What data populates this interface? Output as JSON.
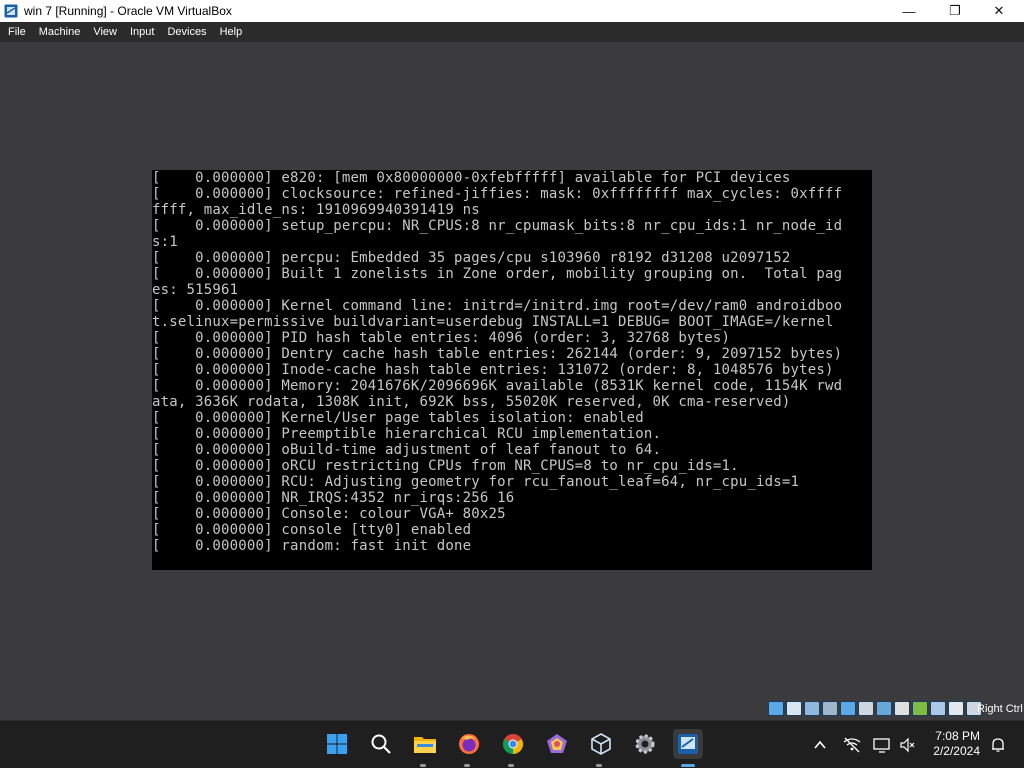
{
  "window": {
    "title": "win 7 [Running] - Oracle VM VirtualBox",
    "minimize": "—",
    "maximize": "❐",
    "close": "✕"
  },
  "menu": [
    "File",
    "Machine",
    "View",
    "Input",
    "Devices",
    "Help"
  ],
  "console": {
    "lines": [
      "[    0.000000] e820: [mem 0x80000000-0xfebfffff] available for PCI devices",
      "[    0.000000] clocksource: refined-jiffies: mask: 0xffffffff max_cycles: 0xffff",
      "ffff, max_idle_ns: 1910969940391419 ns",
      "[    0.000000] setup_percpu: NR_CPUS:8 nr_cpumask_bits:8 nr_cpu_ids:1 nr_node_id",
      "s:1",
      "[    0.000000] percpu: Embedded 35 pages/cpu s103960 r8192 d31208 u2097152",
      "[    0.000000] Built 1 zonelists in Zone order, mobility grouping on.  Total pag",
      "es: 515961",
      "[    0.000000] Kernel command line: initrd=/initrd.img root=/dev/ram0 androidboo",
      "t.selinux=permissive buildvariant=userdebug INSTALL=1 DEBUG= BOOT_IMAGE=/kernel",
      "[    0.000000] PID hash table entries: 4096 (order: 3, 32768 bytes)",
      "[    0.000000] Dentry cache hash table entries: 262144 (order: 9, 2097152 bytes)",
      "[    0.000000] Inode-cache hash table entries: 131072 (order: 8, 1048576 bytes)",
      "[    0.000000] Memory: 2041676K/2096696K available (8531K kernel code, 1154K rwd",
      "ata, 3636K rodata, 1308K init, 692K bss, 55020K reserved, 0K cma-reserved)",
      "[    0.000000] Kernel/User page tables isolation: enabled",
      "[    0.000000] Preemptible hierarchical RCU implementation.",
      "[    0.000000] \tBuild-time adjustment of leaf fanout to 64.",
      "[    0.000000] \tRCU restricting CPUs from NR_CPUS=8 to nr_cpu_ids=1.",
      "[    0.000000] RCU: Adjusting geometry for rcu_fanout_leaf=64, nr_cpu_ids=1",
      "[    0.000000] NR_IRQS:4352 nr_irqs:256 16",
      "[    0.000000] Console: colour VGA+ 80x25",
      "[    0.000000] console [tty0] enabled",
      "[    0.000000] random: fast init done"
    ]
  },
  "statusbar": {
    "host_key": "Right Ctrl",
    "icons": [
      "hard-disk-icon",
      "optical-drive-icon",
      "audio-icon",
      "network-icon",
      "usb-icon",
      "shared-folder-icon",
      "display-icon",
      "recording-icon",
      "guest-additions-icon",
      "cpu-icon",
      "mouse-integration-icon",
      "keyboard-icon"
    ]
  },
  "taskbar": {
    "apps": [
      "windows-start",
      "search",
      "file-explorer",
      "firefox",
      "chrome",
      "app-pentagon",
      "virtualbox",
      "settings",
      "virtualbox-vm-win7"
    ],
    "tray": [
      "show-hidden-icons",
      "network",
      "display",
      "volume",
      "notifications"
    ],
    "time": "7:08 PM",
    "date": "2/2/2024"
  },
  "colors": {
    "console_text": "#c6c6c6",
    "console_bg": "#000000",
    "guest_bg": "#3b3b3d",
    "menubar_bg": "#2b2b2b",
    "taskbar_bg": "#1f1f1f",
    "accent": "#5aa9e6"
  }
}
